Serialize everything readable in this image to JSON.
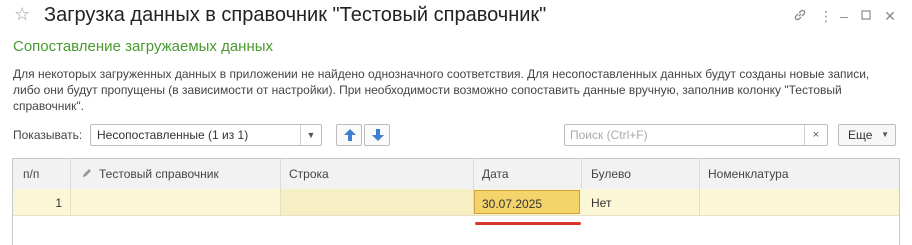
{
  "window": {
    "title": "Загрузка данных в справочник \"Тестовый справочник\"",
    "icons": [
      "star-icon",
      "link-icon",
      "more-vertical-icon",
      "minimize-icon",
      "maximize-icon",
      "close-icon"
    ]
  },
  "form": {
    "subtitle": "Сопоставление загружаемых данных",
    "description": "Для некоторых загруженных данных в приложении не найдено однозначного соответствия.  Для несопоставленных данных будут созданы новые записи, либо они будут пропущены (в зависимости от настройки). При необходимости возможно сопоставить данные вручную, заполнив колонку \"Тестовый справочник\"."
  },
  "toolbar": {
    "show_label": "Показывать:",
    "show_value": "Несопоставленные (1 из 1)",
    "search_placeholder": "Поиск (Ctrl+F)",
    "search_clear": "×",
    "more_label": "Еще"
  },
  "table": {
    "columns": [
      "п/п",
      "Тестовый справочник",
      "Строка",
      "Дата",
      "Булево",
      "Номенклатура"
    ],
    "rows": [
      [
        "1",
        "",
        "",
        "30.07.2025",
        "Нет",
        ""
      ]
    ]
  },
  "colors": {
    "subtitle": "#4a9a2f",
    "row_highlight": "#fbf6d6",
    "focus_cell": "#f4d36a",
    "annotation": "#d9362b",
    "arrow_buttons": "#3a7fd0"
  }
}
